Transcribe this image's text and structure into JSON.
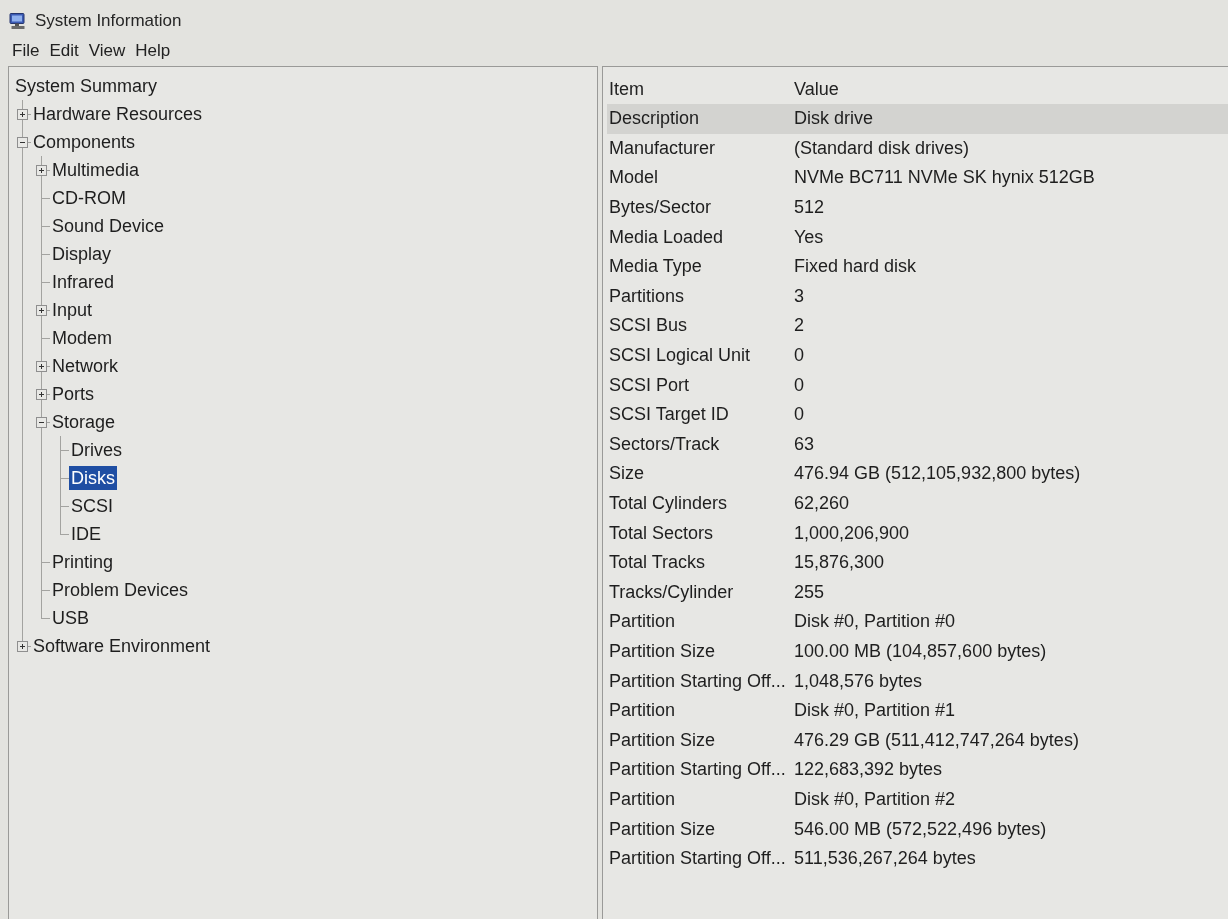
{
  "window": {
    "title": "System Information"
  },
  "menu": [
    "File",
    "Edit",
    "View",
    "Help"
  ],
  "tree": [
    {
      "label": "System Summary",
      "selected": false,
      "children": [
        {
          "label": "Hardware Resources",
          "selected": false,
          "expanded": false
        },
        {
          "label": "Components",
          "selected": false,
          "expanded": true,
          "children": [
            {
              "label": "Multimedia",
              "selected": false,
              "expanded": false
            },
            {
              "label": "CD-ROM",
              "selected": false
            },
            {
              "label": "Sound Device",
              "selected": false
            },
            {
              "label": "Display",
              "selected": false
            },
            {
              "label": "Infrared",
              "selected": false
            },
            {
              "label": "Input",
              "selected": false,
              "expanded": false
            },
            {
              "label": "Modem",
              "selected": false
            },
            {
              "label": "Network",
              "selected": false,
              "expanded": false
            },
            {
              "label": "Ports",
              "selected": false,
              "expanded": false
            },
            {
              "label": "Storage",
              "selected": false,
              "expanded": true,
              "children": [
                {
                  "label": "Drives",
                  "selected": false
                },
                {
                  "label": "Disks",
                  "selected": true
                },
                {
                  "label": "SCSI",
                  "selected": false
                },
                {
                  "label": "IDE",
                  "selected": false
                }
              ]
            },
            {
              "label": "Printing",
              "selected": false
            },
            {
              "label": "Problem Devices",
              "selected": false
            },
            {
              "label": "USB",
              "selected": false
            }
          ]
        },
        {
          "label": "Software Environment",
          "selected": false,
          "expanded": false
        }
      ]
    }
  ],
  "table": {
    "columns": [
      "Item",
      "Value"
    ],
    "rows": [
      {
        "item": "Description",
        "value": "Disk drive",
        "selected": true
      },
      {
        "item": "Manufacturer",
        "value": "(Standard disk drives)",
        "selected": false
      },
      {
        "item": "Model",
        "value": "NVMe BC711 NVMe SK hynix 512GB",
        "selected": false
      },
      {
        "item": "Bytes/Sector",
        "value": "512",
        "selected": false
      },
      {
        "item": "Media Loaded",
        "value": "Yes",
        "selected": false
      },
      {
        "item": "Media Type",
        "value": "Fixed hard disk",
        "selected": false
      },
      {
        "item": "Partitions",
        "value": "3",
        "selected": false
      },
      {
        "item": "SCSI Bus",
        "value": "2",
        "selected": false
      },
      {
        "item": "SCSI Logical Unit",
        "value": "0",
        "selected": false
      },
      {
        "item": "SCSI Port",
        "value": "0",
        "selected": false
      },
      {
        "item": "SCSI Target ID",
        "value": "0",
        "selected": false
      },
      {
        "item": "Sectors/Track",
        "value": "63",
        "selected": false
      },
      {
        "item": "Size",
        "value": "476.94 GB (512,105,932,800 bytes)",
        "selected": false
      },
      {
        "item": "Total Cylinders",
        "value": "62,260",
        "selected": false
      },
      {
        "item": "Total Sectors",
        "value": "1,000,206,900",
        "selected": false
      },
      {
        "item": "Total Tracks",
        "value": "15,876,300",
        "selected": false
      },
      {
        "item": "Tracks/Cylinder",
        "value": "255",
        "selected": false
      },
      {
        "item": "Partition",
        "value": "Disk #0, Partition #0",
        "selected": false
      },
      {
        "item": "Partition Size",
        "value": "100.00 MB (104,857,600 bytes)",
        "selected": false
      },
      {
        "item": "Partition Starting Off...",
        "value": "1,048,576 bytes",
        "selected": false
      },
      {
        "item": "Partition",
        "value": "Disk #0, Partition #1",
        "selected": false
      },
      {
        "item": "Partition Size",
        "value": "476.29 GB (511,412,747,264 bytes)",
        "selected": false
      },
      {
        "item": "Partition Starting Off...",
        "value": "122,683,392 bytes",
        "selected": false
      },
      {
        "item": "Partition",
        "value": "Disk #0, Partition #2",
        "selected": false
      },
      {
        "item": "Partition Size",
        "value": "546.00 MB (572,522,496 bytes)",
        "selected": false
      },
      {
        "item": "Partition Starting Off...",
        "value": "511,536,267,264 bytes",
        "selected": false
      }
    ]
  }
}
